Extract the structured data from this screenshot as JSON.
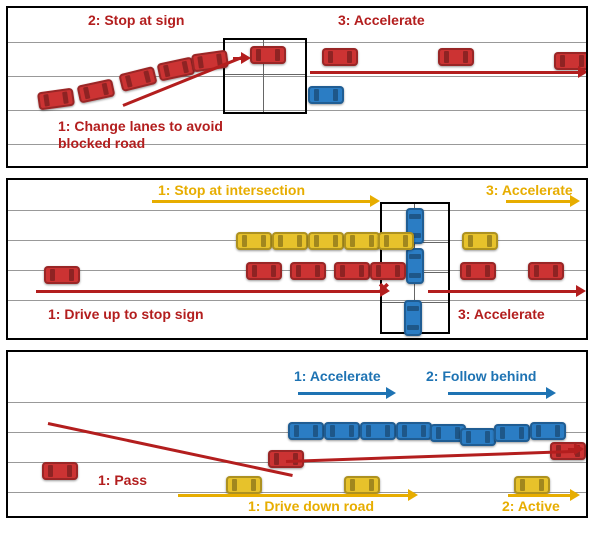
{
  "scenarios": [
    {
      "id": "scenario-1",
      "vehicles": [
        "red",
        "blue"
      ],
      "labels": {
        "a": "2: Stop at sign",
        "b": "3: Accelerate",
        "c": "1: Change lanes to avoid blocked road"
      }
    },
    {
      "id": "scenario-2",
      "vehicles": [
        "red",
        "yellow",
        "blue"
      ],
      "labels": {
        "y1": "1: Stop at intersection",
        "y3": "3: Accelerate",
        "r1": "1: Drive up to stop sign",
        "r3": "3: Accelerate"
      }
    },
    {
      "id": "scenario-3",
      "vehicles": [
        "red",
        "blue",
        "yellow"
      ],
      "labels": {
        "b1": "1: Accelerate",
        "b2": "2: Follow behind",
        "r1": "1: Pass",
        "y1": "1: Drive down road",
        "y2": "2: Active"
      }
    }
  ],
  "chart_data": [
    {
      "type": "diagram",
      "title": "Lane-change around obstacle at intersection",
      "agents": [
        {
          "id": "red-car",
          "role": "ego",
          "actions": [
            {
              "step": 1,
              "text": "Change lanes to avoid blocked road"
            },
            {
              "step": 2,
              "text": "Stop at sign"
            },
            {
              "step": 3,
              "text": "Accelerate"
            }
          ]
        },
        {
          "id": "blue-car",
          "role": "obstacle",
          "actions": []
        }
      ]
    },
    {
      "type": "diagram",
      "title": "Four-way intersection with two approaching vehicles",
      "agents": [
        {
          "id": "yellow-car",
          "role": "other",
          "actions": [
            {
              "step": 1,
              "text": "Stop at intersection"
            },
            {
              "step": 3,
              "text": "Accelerate"
            }
          ]
        },
        {
          "id": "red-car",
          "role": "ego",
          "actions": [
            {
              "step": 1,
              "text": "Drive up to stop sign"
            },
            {
              "step": 3,
              "text": "Accelerate"
            }
          ]
        },
        {
          "id": "blue-cars",
          "role": "cross-traffic",
          "actions": []
        }
      ]
    },
    {
      "type": "diagram",
      "title": "Passing / following scenario",
      "agents": [
        {
          "id": "blue-car",
          "role": "lead",
          "actions": [
            {
              "step": 1,
              "text": "Accelerate"
            },
            {
              "step": 2,
              "text": "Follow behind"
            }
          ]
        },
        {
          "id": "red-car",
          "role": "ego",
          "actions": [
            {
              "step": 1,
              "text": "Pass"
            }
          ]
        },
        {
          "id": "yellow-car",
          "role": "other",
          "actions": [
            {
              "step": 1,
              "text": "Drive down road"
            },
            {
              "step": 2,
              "text": "Active"
            }
          ]
        }
      ]
    }
  ]
}
